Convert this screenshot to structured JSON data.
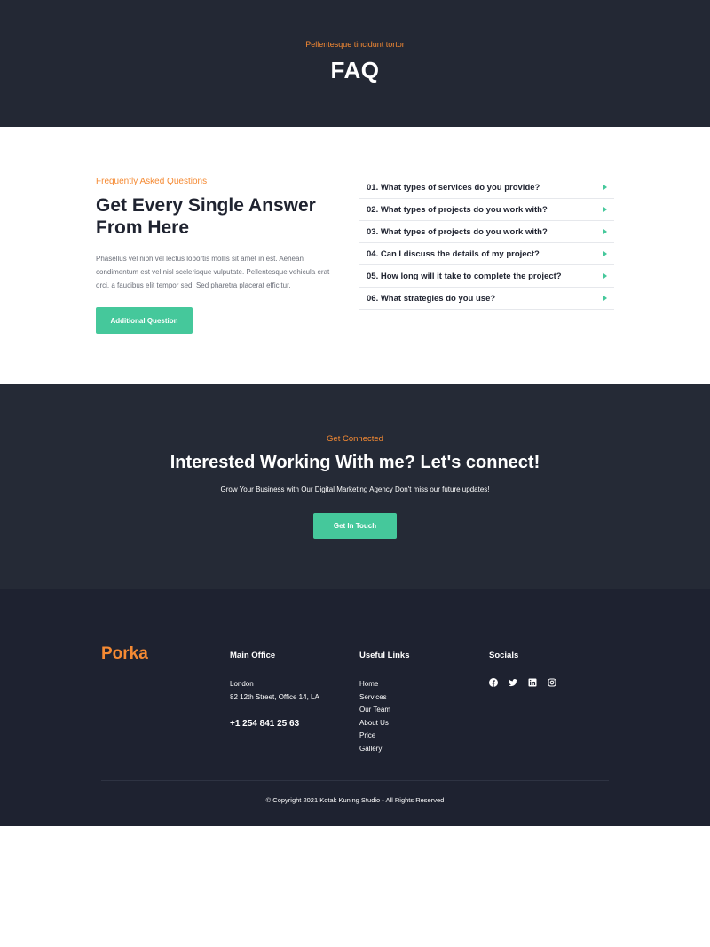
{
  "hero": {
    "kicker": "Pellentesque tincidunt tortor",
    "title": "FAQ"
  },
  "faq": {
    "kicker": "Frequently Asked Questions",
    "heading": "Get Every Single Answer From Here",
    "text": "Phasellus vel nibh vel lectus lobortis mollis sit amet in est. Aenean condimentum est vel nisl scelerisque vulputate. Pellentesque vehicula erat orci, a faucibus elit tempor sed. Sed pharetra placerat efficitur.",
    "button_label": "Additional Question",
    "questions": [
      "01. What types of services do you provide?",
      "02. What types of projects do you work with?",
      "03. What types of projects do you work with?",
      "04. Can I discuss the details of my project?",
      "05. How long will it take to complete the project?",
      "06. What strategies do you use?"
    ]
  },
  "connect": {
    "kicker": "Get Connected",
    "title": "Interested Working With me? Let's connect!",
    "subtitle": "Grow Your Business with Our Digital Marketing Agency Don't miss our future updates!",
    "button_label": "Get In Touch"
  },
  "footer": {
    "brand": "Porka",
    "office": {
      "title": "Main Office",
      "city": "London",
      "address": "82 12th Street, Office 14, LA",
      "phone": "+1 254 841 25 63"
    },
    "links": {
      "title": "Useful Links",
      "items": [
        "Home",
        "Services",
        "Our Team",
        "About Us",
        "Price",
        "Gallery"
      ]
    },
    "socials": {
      "title": "Socials",
      "icons": [
        "facebook-icon",
        "twitter-icon",
        "linkedin-icon",
        "instagram-icon"
      ]
    },
    "copyright": "© Copyright 2021 Kotak Kuning Studio - All Rights Reserved"
  },
  "colors": {
    "accent": "#f58a33",
    "button": "#45c89b",
    "dark": "#232834"
  }
}
